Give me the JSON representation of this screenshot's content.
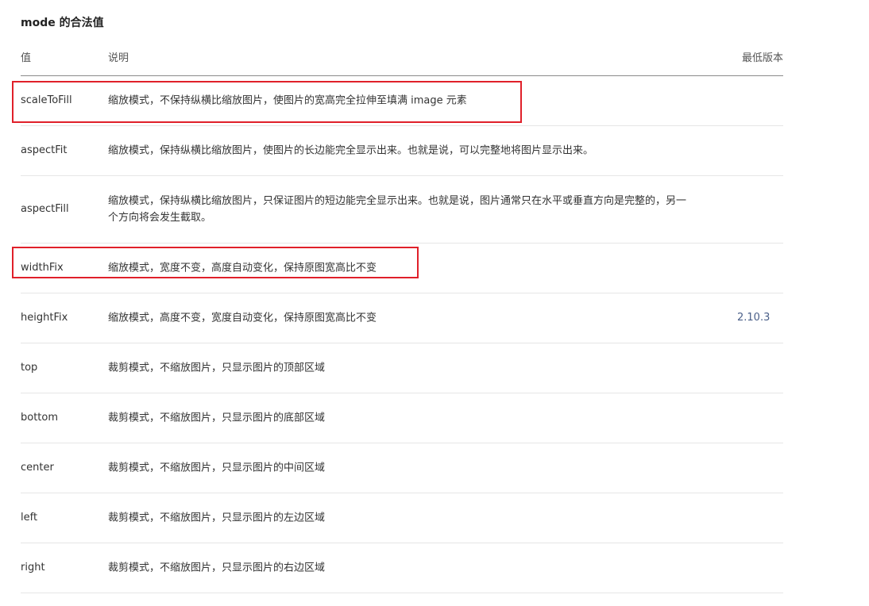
{
  "page": {
    "title": "mode 的合法值"
  },
  "table": {
    "headers": {
      "value": "值",
      "description": "说明",
      "min_version": "最低版本"
    },
    "rows": [
      {
        "value": "scaleToFill",
        "description": "缩放模式，不保持纵横比缩放图片，使图片的宽高完全拉伸至填满 image 元素",
        "min_version": "",
        "highlighted": true
      },
      {
        "value": "aspectFit",
        "description": "缩放模式，保持纵横比缩放图片，使图片的长边能完全显示出来。也就是说，可以完整地将图片显示出来。",
        "min_version": "",
        "highlighted": false
      },
      {
        "value": "aspectFill",
        "description": "缩放模式，保持纵横比缩放图片，只保证图片的短边能完全显示出来。也就是说，图片通常只在水平或垂直方向是完整的，另一个方向将会发生截取。",
        "min_version": "",
        "highlighted": false
      },
      {
        "value": "widthFix",
        "description": "缩放模式，宽度不变，高度自动变化，保持原图宽高比不变",
        "min_version": "",
        "highlighted": true
      },
      {
        "value": "heightFix",
        "description": "缩放模式，高度不变，宽度自动变化，保持原图宽高比不变",
        "min_version": "2.10.3",
        "highlighted": false
      },
      {
        "value": "top",
        "description": "裁剪模式，不缩放图片，只显示图片的顶部区域",
        "min_version": "",
        "highlighted": false
      },
      {
        "value": "bottom",
        "description": "裁剪模式，不缩放图片，只显示图片的底部区域",
        "min_version": "",
        "highlighted": false
      },
      {
        "value": "center",
        "description": "裁剪模式，不缩放图片，只显示图片的中间区域",
        "min_version": "",
        "highlighted": false
      },
      {
        "value": "left",
        "description": "裁剪模式，不缩放图片，只显示图片的左边区域",
        "min_version": "",
        "highlighted": false
      },
      {
        "value": "right",
        "description": "裁剪模式，不缩放图片，只显示图片的右边区域",
        "min_version": "",
        "highlighted": false
      }
    ]
  },
  "colors": {
    "text": "#333333",
    "header_text": "#555555",
    "version_text": "#4a5f88",
    "highlight": "#e0202a",
    "row_divider": "#e6e6e6"
  }
}
